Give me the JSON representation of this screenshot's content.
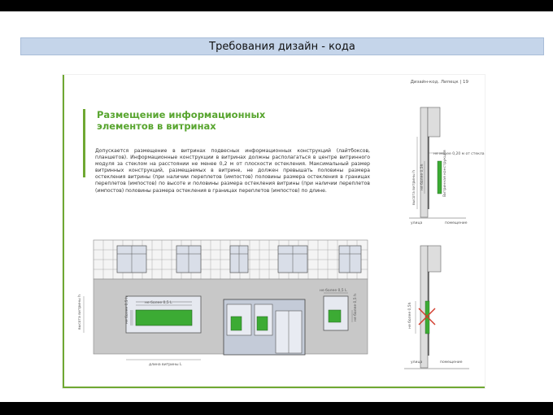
{
  "slide": {
    "title": "Требования дизайн - кода"
  },
  "sheet": {
    "page_label": "Дизайн-код. Липецк  |  19",
    "heading_line1": "Размещение информационных",
    "heading_line2": "элементов в витринах",
    "body": "Допускается размещение в витринах подвесных информационных конструкций (лайтбоксов, планшетов). Информационные конструкции в витринах должны располагаться в центре витринного модуля за стеклом на расстоянии не менее 0,2 м от плоскости остекления. Максимальный размер витринных конструкций, размещаемых в витрине, не должен превышать половины размера остекления витрины (при наличии переплетов (импостов) половины размера остекления в границах переплетов (импостов) по высоте и половины размера остекления витрины (при наличии переплетов (импостов) половины размера остекления в границах переплетов (импостов) по длине."
  },
  "facade": {
    "dim_max_width_left": "не более 0,5 L",
    "dim_max_height_left": "не более 0,5 h",
    "dim_max_width_right": "не более 0,5 L",
    "dim_max_height_right": "не более 0,5 h",
    "dim_window_height": "высота витрины h",
    "dim_window_length": "длина витрины L"
  },
  "section_top": {
    "dim_distance": "не менее 0,20 м от стекла",
    "dim_height": "высота витрины h",
    "dim_half_height": "не более 0,5h",
    "label_vertical": "Витринная конструкция",
    "label_street": "улица",
    "label_room": "помещение"
  },
  "section_bottom": {
    "dim_half_height": "не более 0,5h",
    "label_street": "улица",
    "label_room": "помещение"
  },
  "colors": {
    "accent_green": "#6fa832",
    "sign_green": "#3cab34",
    "title_bar": "#c5d5ea",
    "facade_grey": "#c8c8c8"
  }
}
